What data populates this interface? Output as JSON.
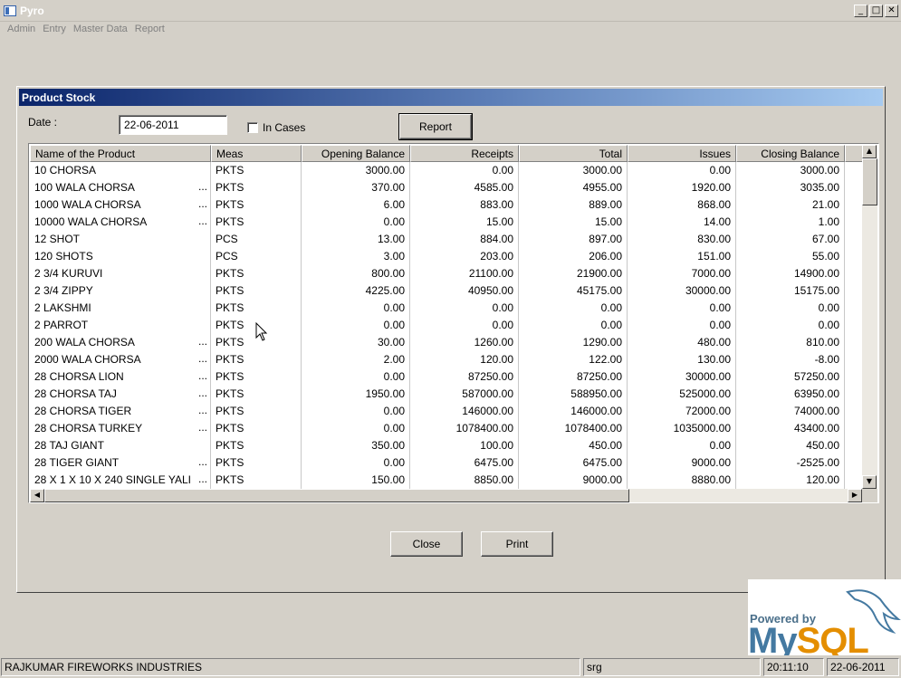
{
  "window": {
    "title": "Pyro"
  },
  "menu": [
    "Admin",
    "Entry",
    "Master Data",
    "Report"
  ],
  "dialog": {
    "title": "Product Stock",
    "date_label": "Date :",
    "date_value": "22-06-2011",
    "in_cases_label": "In Cases",
    "in_cases_checked": false,
    "report_button": "Report",
    "close_button": "Close",
    "print_button": "Print"
  },
  "table": {
    "columns": [
      "Name of the Product",
      "Meas",
      "Opening Balance",
      "Receipts",
      "Total",
      "Issues",
      "Closing Balance"
    ],
    "rows": [
      {
        "name": "10 CHORSA",
        "more": "",
        "meas": "PKTS",
        "opening": "3000.00",
        "receipts": "0.00",
        "total": "3000.00",
        "issues": "0.00",
        "closing": "3000.00"
      },
      {
        "name": "100 WALA CHORSA",
        "more": "...",
        "meas": "PKTS",
        "opening": "370.00",
        "receipts": "4585.00",
        "total": "4955.00",
        "issues": "1920.00",
        "closing": "3035.00"
      },
      {
        "name": "1000 WALA CHORSA",
        "more": "...",
        "meas": "PKTS",
        "opening": "6.00",
        "receipts": "883.00",
        "total": "889.00",
        "issues": "868.00",
        "closing": "21.00"
      },
      {
        "name": "10000 WALA CHORSA",
        "more": "...",
        "meas": "PKTS",
        "opening": "0.00",
        "receipts": "15.00",
        "total": "15.00",
        "issues": "14.00",
        "closing": "1.00"
      },
      {
        "name": "12 SHOT",
        "more": "",
        "meas": "PCS",
        "opening": "13.00",
        "receipts": "884.00",
        "total": "897.00",
        "issues": "830.00",
        "closing": "67.00"
      },
      {
        "name": "120 SHOTS",
        "more": "",
        "meas": "PCS",
        "opening": "3.00",
        "receipts": "203.00",
        "total": "206.00",
        "issues": "151.00",
        "closing": "55.00"
      },
      {
        "name": "2 3/4 KURUVI",
        "more": "",
        "meas": "PKTS",
        "opening": "800.00",
        "receipts": "21100.00",
        "total": "21900.00",
        "issues": "7000.00",
        "closing": "14900.00"
      },
      {
        "name": "2 3/4 ZIPPY",
        "more": "",
        "meas": "PKTS",
        "opening": "4225.00",
        "receipts": "40950.00",
        "total": "45175.00",
        "issues": "30000.00",
        "closing": "15175.00"
      },
      {
        "name": "2 LAKSHMI",
        "more": "",
        "meas": "PKTS",
        "opening": "0.00",
        "receipts": "0.00",
        "total": "0.00",
        "issues": "0.00",
        "closing": "0.00"
      },
      {
        "name": "2 PARROT",
        "more": "",
        "meas": "PKTS",
        "opening": "0.00",
        "receipts": "0.00",
        "total": "0.00",
        "issues": "0.00",
        "closing": "0.00"
      },
      {
        "name": "200 WALA CHORSA",
        "more": "...",
        "meas": "PKTS",
        "opening": "30.00",
        "receipts": "1260.00",
        "total": "1290.00",
        "issues": "480.00",
        "closing": "810.00"
      },
      {
        "name": "2000 WALA CHORSA",
        "more": "...",
        "meas": "PKTS",
        "opening": "2.00",
        "receipts": "120.00",
        "total": "122.00",
        "issues": "130.00",
        "closing": "-8.00"
      },
      {
        "name": "28 CHORSA LION",
        "more": "...",
        "meas": "PKTS",
        "opening": "0.00",
        "receipts": "87250.00",
        "total": "87250.00",
        "issues": "30000.00",
        "closing": "57250.00"
      },
      {
        "name": "28 CHORSA TAJ",
        "more": "...",
        "meas": "PKTS",
        "opening": "1950.00",
        "receipts": "587000.00",
        "total": "588950.00",
        "issues": "525000.00",
        "closing": "63950.00"
      },
      {
        "name": "28 CHORSA TIGER",
        "more": "...",
        "meas": "PKTS",
        "opening": "0.00",
        "receipts": "146000.00",
        "total": "146000.00",
        "issues": "72000.00",
        "closing": "74000.00"
      },
      {
        "name": "28 CHORSA TURKEY",
        "more": "...",
        "meas": "PKTS",
        "opening": "0.00",
        "receipts": "1078400.00",
        "total": "1078400.00",
        "issues": "1035000.00",
        "closing": "43400.00"
      },
      {
        "name": "28 TAJ GIANT",
        "more": "",
        "meas": "PKTS",
        "opening": "350.00",
        "receipts": "100.00",
        "total": "450.00",
        "issues": "0.00",
        "closing": "450.00"
      },
      {
        "name": "28 TIGER GIANT",
        "more": "...",
        "meas": "PKTS",
        "opening": "0.00",
        "receipts": "6475.00",
        "total": "6475.00",
        "issues": "9000.00",
        "closing": "-2525.00"
      },
      {
        "name": "28 X 1 X 10 X 240 SINGLE YALI",
        "more": "...",
        "meas": "PKTS",
        "opening": "150.00",
        "receipts": "8850.00",
        "total": "9000.00",
        "issues": "8880.00",
        "closing": "120.00"
      }
    ]
  },
  "logo": {
    "powered": "Powered by",
    "brand_a": "My",
    "brand_b": "SQL"
  },
  "status": {
    "company": "RAJKUMAR FIREWORKS INDUSTRIES",
    "user": "srg",
    "time": "20:11:10",
    "date": "22-06-2011"
  },
  "icons": {
    "scroll_up": "up-arrow-icon",
    "scroll_down": "down-arrow-icon",
    "scroll_left": "left-arrow-icon",
    "scroll_right": "right-arrow-icon",
    "cursor": "mouse-pointer-icon"
  }
}
